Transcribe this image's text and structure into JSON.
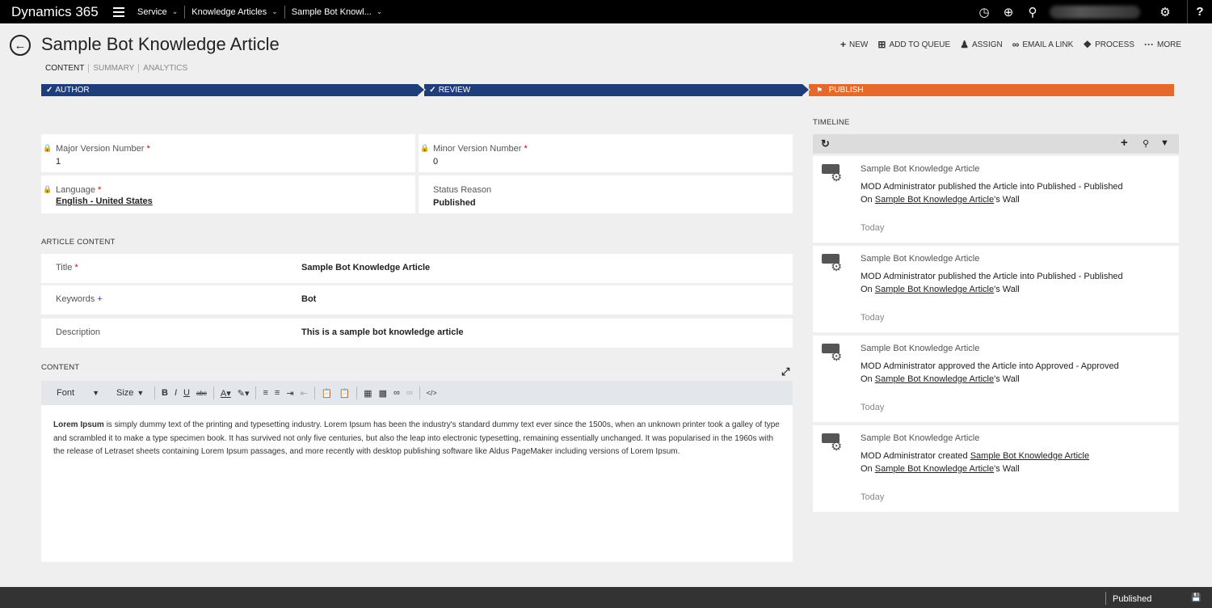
{
  "topnav": {
    "brand": "Dynamics 365",
    "crumbs": [
      "Service",
      "Knowledge Articles",
      "Sample Bot Knowl..."
    ]
  },
  "header": {
    "title": "Sample Bot Knowledge Article",
    "tabs": [
      "CONTENT",
      "SUMMARY",
      "ANALYTICS"
    ],
    "commands": [
      "NEW",
      "ADD TO QUEUE",
      "ASSIGN",
      "EMAIL A LINK",
      "PROCESS",
      "MORE"
    ]
  },
  "process": {
    "stages": [
      "AUTHOR",
      "REVIEW",
      "PUBLISH"
    ],
    "colors": {
      "done": "#1f3d7a",
      "active": "#e4692a"
    }
  },
  "fields": {
    "major_label": "Major Version Number",
    "major_value": "1",
    "minor_label": "Minor Version Number",
    "minor_value": "0",
    "language_label": "Language",
    "language_value": "English - United States",
    "status_label": "Status Reason",
    "status_value": "Published",
    "required_mark": "*"
  },
  "article": {
    "section_title": "ARTICLE CONTENT",
    "title_label": "Title",
    "title_value": "Sample Bot Knowledge Article",
    "keywords_label": "Keywords",
    "keywords_mark": "+",
    "keywords_value": "Bot",
    "description_label": "Description",
    "description_value": "This is a sample bot knowledge article"
  },
  "content": {
    "section_title": "CONTENT",
    "font_select": "Font",
    "size_select": "Size",
    "body_bold": "Lorem Ipsum",
    "body_text": " is simply dummy text of the printing and typesetting industry. Lorem Ipsum has been the industry's standard dummy text ever since the 1500s, when an unknown printer took a galley of type and scrambled it to make a type specimen book. It has survived not only five centuries, but also the leap into electronic typesetting, remaining essentially unchanged. It was popularised in the 1960s with the release of Letraset sheets containing Lorem Ipsum passages, and more recently with desktop publishing software like Aldus PageMaker including versions of Lorem Ipsum."
  },
  "timeline": {
    "title": "TIMELINE",
    "posts": [
      {
        "head": "Sample Bot Knowledge Article",
        "pre": "MOD Administrator published the Article into Published - Published",
        "link": "",
        "on": "On ",
        "wall_link": "Sample Bot Knowledge Article",
        "wall": "'s Wall",
        "date": "Today"
      },
      {
        "head": "Sample Bot Knowledge Article",
        "pre": "MOD Administrator published the Article into Published - Published",
        "link": "",
        "on": "On ",
        "wall_link": "Sample Bot Knowledge Article",
        "wall": "'s Wall",
        "date": "Today"
      },
      {
        "head": "Sample Bot Knowledge Article",
        "pre": "MOD Administrator approved the Article into Approved - Approved",
        "link": "",
        "on": "On ",
        "wall_link": "Sample Bot Knowledge Article",
        "wall": "'s Wall",
        "date": "Today"
      },
      {
        "head": "Sample Bot Knowledge Article",
        "pre": "MOD Administrator created ",
        "link": "Sample Bot Knowledge Article",
        "on": "On ",
        "wall_link": "Sample Bot Knowledge Article",
        "wall": "'s Wall",
        "date": "Today"
      }
    ]
  },
  "footer": {
    "status": "Published"
  }
}
